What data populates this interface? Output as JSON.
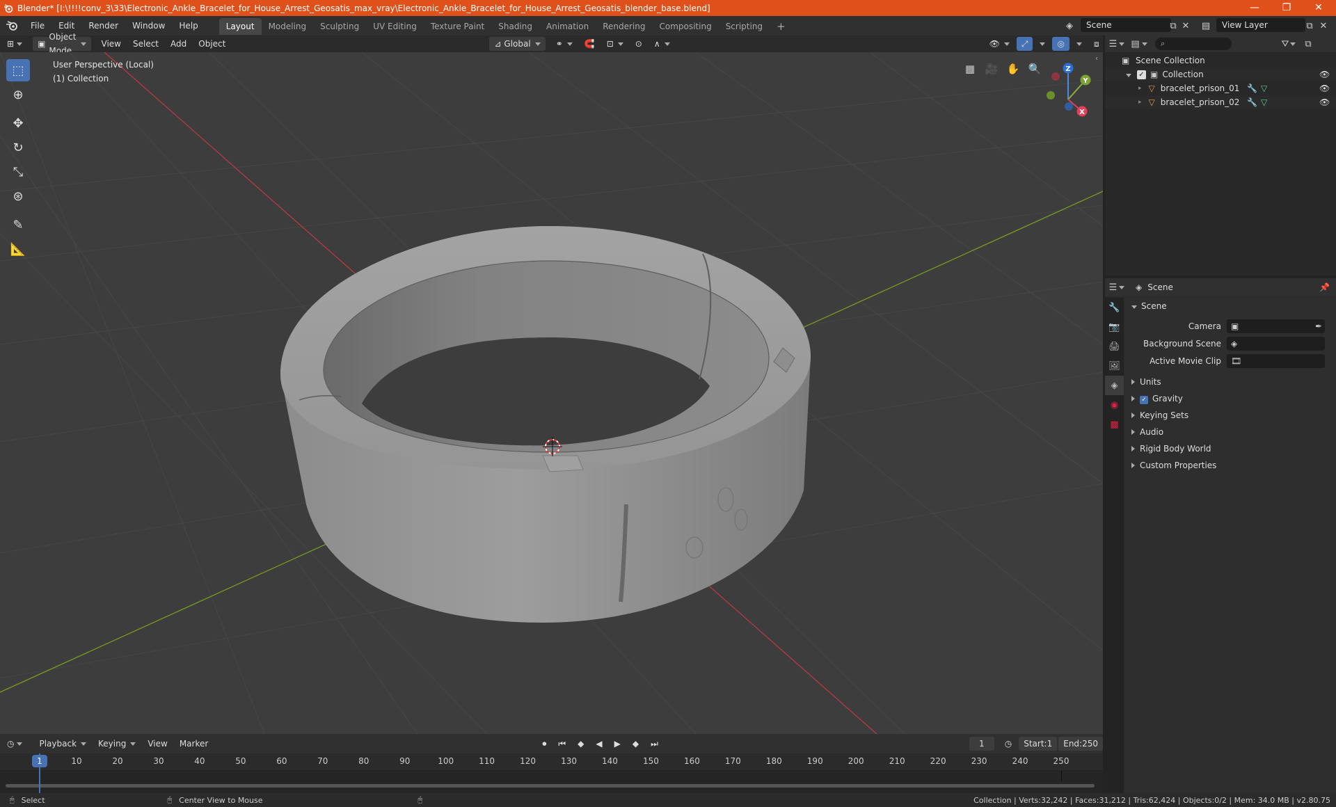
{
  "window": {
    "title": "Blender* [I:\\!!!!conv_3\\33\\Electronic_Ankle_Bracelet_for_House_Arrest_Geosatis_max_vray\\Electronic_Ankle_Bracelet_for_House_Arrest_Geosatis_blender_base.blend]",
    "minimize": "—",
    "maximize": "❐",
    "close": "✕"
  },
  "menu": [
    "File",
    "Edit",
    "Render",
    "Window",
    "Help"
  ],
  "workspaces": {
    "active": "Layout",
    "tabs": [
      "Layout",
      "Modeling",
      "Sculpting",
      "UV Editing",
      "Texture Paint",
      "Shading",
      "Animation",
      "Rendering",
      "Compositing",
      "Scripting"
    ],
    "add": "+"
  },
  "scene_selector": {
    "value": "Scene"
  },
  "view_layer_selector": {
    "value": "View Layer"
  },
  "viewport_header": {
    "mode": "Object Mode",
    "menus": [
      "View",
      "Select",
      "Add",
      "Object"
    ],
    "transform_orientation": "Global"
  },
  "viewport": {
    "perspective": "User Perspective (Local)",
    "collection": "(1) Collection",
    "gizmo": {
      "x": "X",
      "y": "Y",
      "z": "Z"
    },
    "colors": {
      "x_axis": "#b5384c",
      "y_axis": "#7a9a1e",
      "background": "#3d3d3d",
      "grid": "#4a4a4a"
    }
  },
  "tools": [
    "select-box",
    "cursor",
    "move",
    "rotate",
    "scale",
    "transform",
    "annotate",
    "measure"
  ],
  "outliner": {
    "root": "Scene Collection",
    "collection": "Collection",
    "objects": [
      "bracelet_prison_01",
      "bracelet_prison_02"
    ]
  },
  "properties": {
    "context": "Scene",
    "panel": "Scene",
    "rows": [
      {
        "label": "Camera"
      },
      {
        "label": "Background Scene"
      },
      {
        "label": "Active Movie Clip"
      }
    ],
    "sections": [
      "Units",
      "Gravity",
      "Keying Sets",
      "Audio",
      "Rigid Body World",
      "Custom Properties"
    ]
  },
  "timeline": {
    "menus": [
      "Playback",
      "Keying",
      "View",
      "Marker"
    ],
    "current_frame": "1",
    "start_label": "Start:",
    "start": "1",
    "end_label": "End:",
    "end": "250",
    "ticks": [
      "1",
      "10",
      "20",
      "30",
      "40",
      "50",
      "60",
      "70",
      "80",
      "90",
      "100",
      "110",
      "120",
      "130",
      "140",
      "150",
      "160",
      "170",
      "180",
      "190",
      "200",
      "210",
      "220",
      "230",
      "240",
      "250"
    ],
    "playhead_frame": 1
  },
  "statusbar": {
    "select": "Select",
    "center": "Center View to Mouse",
    "stats": "Collection | Verts:32,242 | Faces:31,212 | Tris:62,424 | Objects:0/2 | Mem: 34.0 MB | v2.80.75"
  }
}
